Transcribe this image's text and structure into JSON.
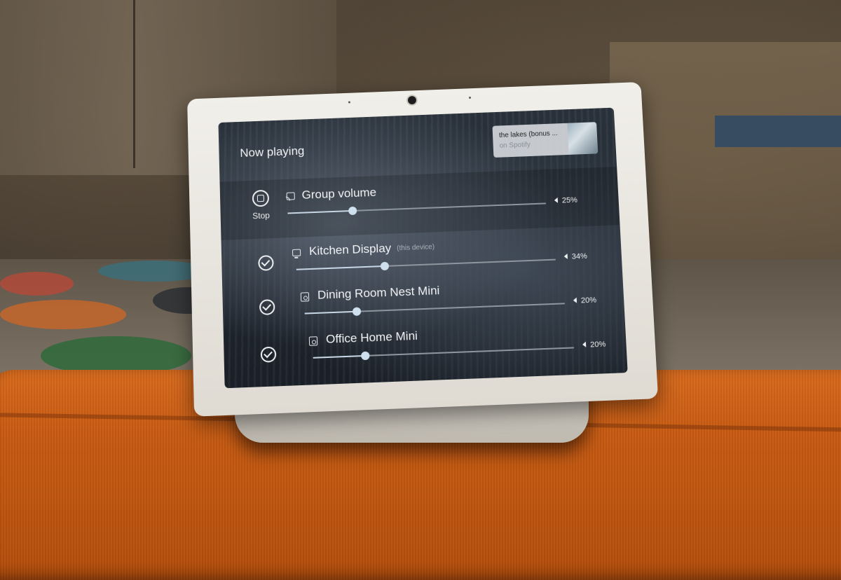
{
  "header": {
    "title": "Now playing"
  },
  "media": {
    "title": "the lakes (bonus ...",
    "source": "on Spotify"
  },
  "group": {
    "label": "Group volume",
    "volume": 25,
    "volume_text": "25%",
    "stop_label": "Stop"
  },
  "devices": [
    {
      "name": "Kitchen Display",
      "note": "(this device)",
      "volume": 34,
      "volume_text": "34%",
      "selected": true
    },
    {
      "name": "Dining Room Nest Mini",
      "note": "",
      "volume": 20,
      "volume_text": "20%",
      "selected": true
    },
    {
      "name": "Office Home Mini",
      "note": "",
      "volume": 20,
      "volume_text": "20%",
      "selected": true
    }
  ],
  "colors": {
    "accent": "#c7d7e6",
    "ottoman": "#d96a1c"
  }
}
